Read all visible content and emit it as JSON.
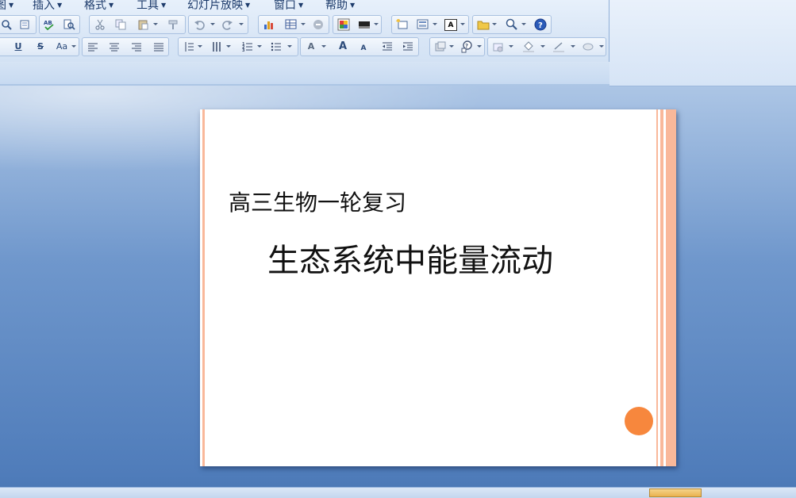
{
  "menu": [
    {
      "label": "图"
    },
    {
      "label": "插入"
    },
    {
      "label": "格式"
    },
    {
      "label": "工具"
    },
    {
      "label": "幻灯片放映"
    },
    {
      "label": "窗口"
    },
    {
      "label": "帮助"
    }
  ],
  "toolbar": {
    "underline_glyph": "U",
    "strikethrough_glyph": "S",
    "change_case_glyph": "Aa",
    "font_color_glyph": "A",
    "grow_font_glyph": "A",
    "shrink_font_glyph": "A",
    "text_box_glyph": "A"
  },
  "slide": {
    "subtitle": "高三生物一轮复习",
    "title": "生态系统中能量流动",
    "accent_color": "#f7873d",
    "stripe_color": "#f9b89a"
  }
}
